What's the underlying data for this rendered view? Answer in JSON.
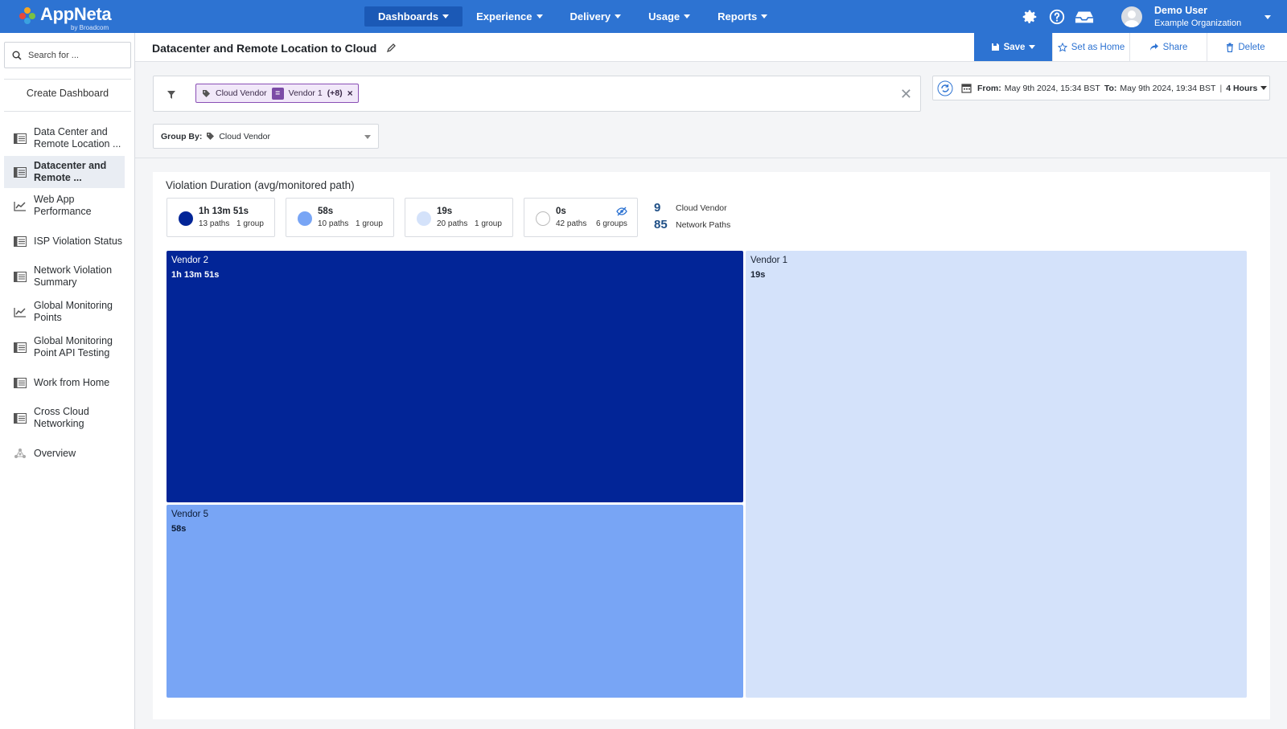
{
  "brand": {
    "name": "AppNeta",
    "sub": "by Broadcom"
  },
  "nav": [
    {
      "label": "Dashboards",
      "active": true
    },
    {
      "label": "Experience",
      "active": false
    },
    {
      "label": "Delivery",
      "active": false
    },
    {
      "label": "Usage",
      "active": false
    },
    {
      "label": "Reports",
      "active": false
    }
  ],
  "topIcons": [
    "gear-icon",
    "help-icon",
    "inbox-icon"
  ],
  "user": {
    "name": "Demo User",
    "org": "Example Organization"
  },
  "sidebar": {
    "search_placeholder": "Search for ...",
    "create_label": "Create Dashboard",
    "items": [
      {
        "label": "Data Center and Remote Location ...",
        "icon": "list-icon",
        "active": false
      },
      {
        "label": "Datacenter and Remote ...",
        "icon": "list-icon",
        "active": true
      },
      {
        "label": "Web App Performance",
        "icon": "chart-line-icon",
        "active": false
      },
      {
        "label": "ISP Violation Status",
        "icon": "list-icon",
        "active": false
      },
      {
        "label": "Network Violation Summary",
        "icon": "list-icon",
        "active": false
      },
      {
        "label": "Global Monitoring Points",
        "icon": "chart-line-icon",
        "active": false
      },
      {
        "label": "Global Monitoring Point API Testing",
        "icon": "list-icon",
        "active": false
      },
      {
        "label": "Work from Home",
        "icon": "list-icon",
        "active": false
      },
      {
        "label": "Cross Cloud Networking",
        "icon": "list-icon",
        "active": false
      },
      {
        "label": "Overview",
        "icon": "network-icon",
        "active": false
      }
    ]
  },
  "header": {
    "title": "Datacenter and Remote Location to Cloud",
    "actions": {
      "save": "Save",
      "set_home": "Set as Home",
      "share": "Share",
      "delete": "Delete"
    }
  },
  "filter": {
    "chip_field": "Cloud Vendor",
    "chip_op": "=",
    "chip_value": "Vendor 1",
    "chip_more": "(+8)"
  },
  "time": {
    "from_label": "From:",
    "from": "May 9th 2024, 15:34 BST",
    "to_label": "To:",
    "to": "May 9th 2024, 19:34 BST",
    "sep": "|",
    "range": "4 Hours"
  },
  "groupBy": {
    "label": "Group By:",
    "value": "Cloud Vendor"
  },
  "panel": {
    "title": "Violation Duration (avg/monitored path)",
    "legend": [
      {
        "value": "1h 13m 51s",
        "paths": "13 paths",
        "groups": "1 group",
        "color": "#022597"
      },
      {
        "value": "58s",
        "paths": "10 paths",
        "groups": "1 group",
        "color": "#78a5f5"
      },
      {
        "value": "19s",
        "paths": "20 paths",
        "groups": "1 group",
        "color": "#d4e2fa"
      },
      {
        "value": "0s",
        "paths": "42 paths",
        "groups": "6 groups",
        "color": "#ffffff"
      }
    ],
    "counts": [
      {
        "num": "9",
        "label": "Cloud Vendor"
      },
      {
        "num": "85",
        "label": "Network Paths"
      }
    ]
  },
  "treemap": [
    {
      "name": "Vendor 2",
      "value": "1h 13m 51s",
      "color": "#022597",
      "text": "#ffffff"
    },
    {
      "name": "Vendor 5",
      "value": "58s",
      "color": "#78a5f5",
      "text": "#0b1a33"
    },
    {
      "name": "Vendor 1",
      "value": "19s",
      "color": "#d4e2fa",
      "text": "#1a2333"
    }
  ]
}
